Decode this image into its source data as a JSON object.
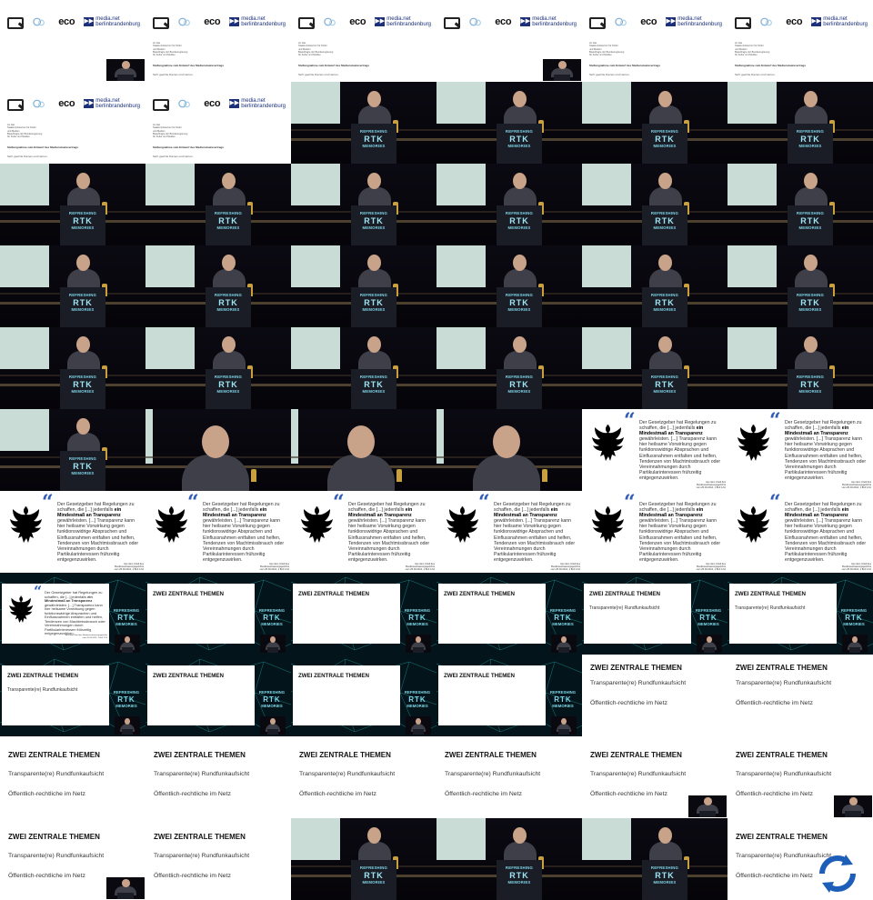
{
  "letter": {
    "eco": "eco",
    "media_sq": "▶▶",
    "media_line1": "media.net",
    "media_line2": "berlinbrandenburg",
    "address": [
      "An das",
      "Staatsministerium für Kultur",
      "und Medien",
      "Beauftragte der Bundesregierung",
      "für Kultur und Medien"
    ],
    "subject": "Stellungnahme zum Entwurf des Medienstaatsvertrags",
    "salutation": "Sehr geehrte Damen und Herren,"
  },
  "podium": {
    "line1": "REFRESHING",
    "line2": "RTK",
    "line3": "MEMORIES"
  },
  "quote": {
    "mark": "“",
    "text_pre": "Der Gesetzgeber hat Regelungen zu schaffen, die [...] jedenfalls ",
    "text_bold": "ein Mindestmaß an Transparenz",
    "text_post": " gewährleisten. [...] Transparenz kann hier heilsame Vorwirkung gegen funktionswidrige Absprachen und Einflussnahmen entfalten und helfen, Tendenzen von Machtmissbrauch oder Vereinnahmungen durch Partikularinteressen frühzeitig entgegenzuwirken.",
    "source_line1": "Aus dem Urteil des Bundesverfassungsgerichts",
    "source_line2": "vom 25.03.2014, 1 BvF 1/11"
  },
  "themes": {
    "title": "ZWEI ZENTRALE THEMEN",
    "item1": "Transparente(re) Rundfunkaufsicht",
    "item2": "Öffentlich-rechtliche im Netz"
  },
  "grid_sequence": [
    "letter-thumb",
    "letter",
    "letter",
    "letter-thumb",
    "letter",
    "letter",
    "letter",
    "letter",
    "stage",
    "stage",
    "stage",
    "stage",
    "stage",
    "stage",
    "stage",
    "stage",
    "stage",
    "stage",
    "stage",
    "stage",
    "stage",
    "stage",
    "stage",
    "stage",
    "stage",
    "stage",
    "stage",
    "stage",
    "stage",
    "stage",
    "stage",
    "close",
    "close",
    "close",
    "quote",
    "quote",
    "quote",
    "quote",
    "quote",
    "quote",
    "quote",
    "quote",
    "net-quote",
    "net-title",
    "net-title",
    "net-title",
    "net-item",
    "net-item",
    "net-item",
    "net-title",
    "net-title",
    "net-title",
    "themes2",
    "themes2",
    "themes",
    "themes",
    "themes",
    "themes",
    "themes-thumb",
    "themes-thumb",
    "themes-thumb",
    "themes",
    "stage",
    "stage",
    "stage",
    "themes-refresh"
  ],
  "colors": {
    "accent_blue": "#2f5bb7",
    "brand_cyan": "#7fd5e8",
    "navy": "#1b2f7a"
  },
  "icons": {
    "refresh": "refresh-icon",
    "eagle": "federal-eagle-icon"
  }
}
